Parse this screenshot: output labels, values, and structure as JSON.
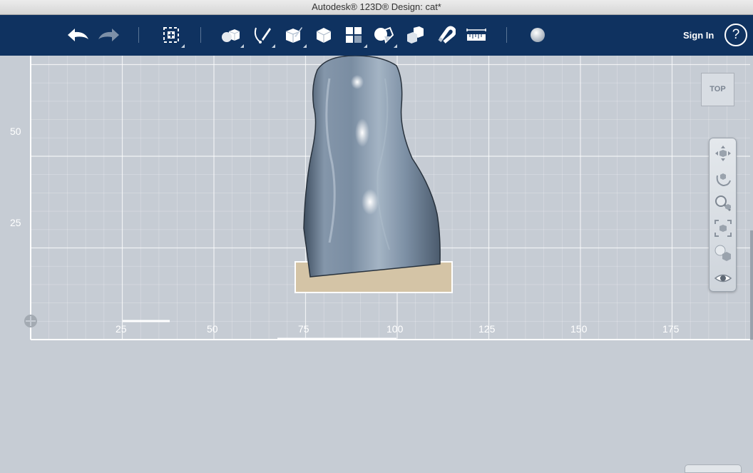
{
  "window": {
    "title": "Autodesk® 123D® Design: cat*"
  },
  "toolbar": {
    "tools": [
      {
        "name": "undo-button",
        "icon": "undo-icon"
      },
      {
        "name": "redo-button",
        "icon": "redo-icon"
      },
      {
        "name": "transform-button",
        "icon": "transform-icon"
      },
      {
        "name": "primitives-button",
        "icon": "primitives-icon"
      },
      {
        "name": "sketch-button",
        "icon": "sketch-icon"
      },
      {
        "name": "construct-button",
        "icon": "construct-icon"
      },
      {
        "name": "modify-button",
        "icon": "modify-icon"
      },
      {
        "name": "pattern-button",
        "icon": "pattern-icon"
      },
      {
        "name": "combine-button",
        "icon": "combine-icon"
      },
      {
        "name": "grouping-button",
        "icon": "grouping-icon"
      },
      {
        "name": "snap-button",
        "icon": "magnet-icon"
      },
      {
        "name": "measure-button",
        "icon": "ruler-icon"
      },
      {
        "name": "material-button",
        "icon": "material-sphere-icon"
      }
    ],
    "sign_in_label": "Sign In",
    "help_label": "?"
  },
  "viewport": {
    "y_labels": [
      "50",
      "25"
    ],
    "x_labels": [
      "25",
      "50",
      "75",
      "100",
      "125",
      "150",
      "175"
    ]
  },
  "viewcube": {
    "label": "TOP"
  },
  "navbar": {
    "buttons": [
      "pan-icon",
      "orbit-icon",
      "zoom-icon",
      "fit-icon",
      "view-style-icon",
      "visibility-eye-icon"
    ]
  },
  "colors": {
    "toolbar_bg": "#0f3260",
    "viewport_bg": "#c6ccd4",
    "model_fill": "#7c8ea0",
    "selection_fill": "#d4c4a6"
  }
}
